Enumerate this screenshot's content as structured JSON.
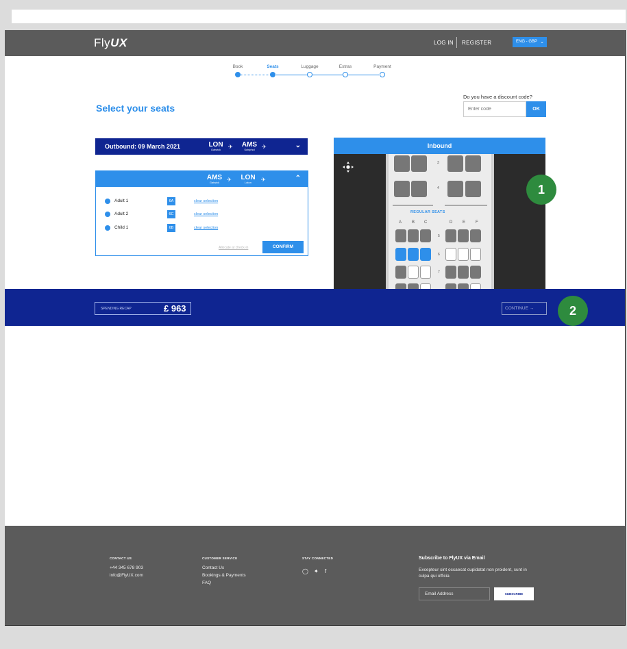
{
  "header": {
    "logo_text": "Fly",
    "logo_accent": "UX",
    "login_label": "LOG IN",
    "register_label": "REGISTER",
    "language": "ENG - GBP"
  },
  "stepper": {
    "steps": [
      {
        "label": "Book",
        "state": "done"
      },
      {
        "label": "Seats",
        "state": "active"
      },
      {
        "label": "Luggage",
        "state": "pending"
      },
      {
        "label": "Extras",
        "state": "pending"
      },
      {
        "label": "Payment",
        "state": "pending"
      }
    ]
  },
  "page_title": "Select your seats",
  "discount": {
    "question": "Do you have a discount code?",
    "placeholder": "Enter code",
    "ok_label": "OK"
  },
  "outbound": {
    "title": "Outbound: 09 March 2021",
    "from_code": "LON",
    "from_airport": "Gatwick",
    "to_code": "AMS",
    "to_airport": "Schiphol"
  },
  "inbound": {
    "from_code": "AMS",
    "from_airport": "Gatwick",
    "to_code": "LON",
    "to_airport": "Luton",
    "passengers": [
      {
        "name": "Adult 1",
        "seat": "6A",
        "action": "clear selection"
      },
      {
        "name": "Adult 2",
        "seat": "6C",
        "action": "clear selection"
      },
      {
        "name": "Child 1",
        "seat": "6B",
        "action": "clear selection"
      }
    ],
    "allocate_label": "Allocate at check-in",
    "confirm_label": "CONFIRM"
  },
  "seat_map": {
    "title": "Inbound",
    "section_label": "REGULAR SEATS",
    "columns": [
      "A",
      "B",
      "C",
      "D",
      "E",
      "F"
    ],
    "rows": [
      "3",
      "4",
      "5",
      "6",
      "7"
    ]
  },
  "recap": {
    "label": "SPENDING RECAP",
    "total": "£ 963",
    "continue_label": "CONTINUE"
  },
  "annotations": {
    "badge_1": "1",
    "badge_2": "2",
    "color": "#2e8b3e"
  },
  "footer": {
    "contact_heading": "CONTACT US",
    "phone": "+44 345 678 903",
    "email": "info@FlyUX.com",
    "service_heading": "CUSTOMER SERVICE",
    "service_links": [
      "Contact Us",
      "Bookings & Payments",
      "FAQ"
    ],
    "social_heading": "STAY CONNECTED",
    "subscribe_title": "Subscribe to FlyUX via Email",
    "subscribe_text": "Excepteur sint occaecat cupidatat non proident, sunt in culpa qui officia",
    "email_placeholder": "Email Address",
    "subscribe_button": "SUBSCRIBE"
  },
  "colors": {
    "accent": "#2e8fea",
    "navy": "#0f2591",
    "header_gray": "#5b5b5b"
  }
}
